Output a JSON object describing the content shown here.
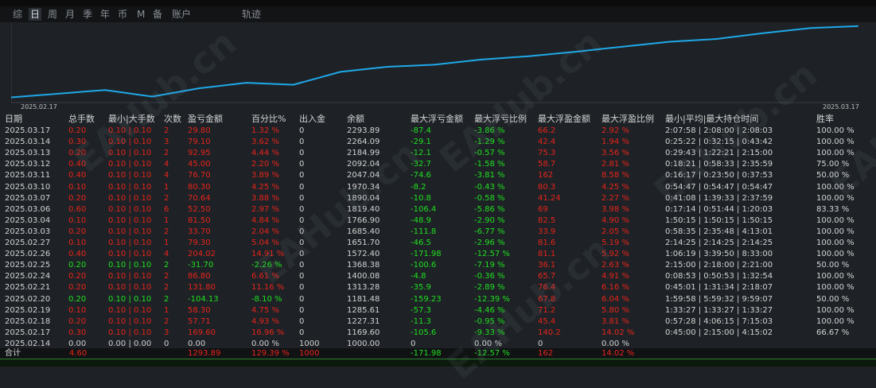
{
  "tabs": [
    "综",
    "日",
    "周",
    "月",
    "季",
    "年",
    "币",
    "M",
    "备",
    "账户",
    "轨迹"
  ],
  "active_tab": "日",
  "chart_data": {
    "type": "line",
    "x": [
      "2025.02.17",
      "2025.02.18",
      "2025.02.19",
      "2025.02.20",
      "2025.02.21",
      "2025.02.24",
      "2025.02.25",
      "2025.02.26",
      "2025.02.27",
      "2025.03.03",
      "2025.03.04",
      "2025.03.06",
      "2025.03.07",
      "2025.03.10",
      "2025.03.11",
      "2025.03.12",
      "2025.03.13",
      "2025.03.14",
      "2025.03.17"
    ],
    "values": [
      1169.6,
      1227.31,
      1285.61,
      1181.48,
      1313.28,
      1400.08,
      1368.38,
      1572.4,
      1651.7,
      1685.4,
      1766.9,
      1819.4,
      1890.04,
      1970.34,
      2047.04,
      2092.04,
      2184.99,
      2264.09,
      2293.89
    ],
    "series_color": "#1fa8e8",
    "start_label": "2025.02.17",
    "end_label": "2025.03.17"
  },
  "headers": [
    "日期",
    "总手数",
    "最小|大手数",
    "次数",
    "盈亏金额",
    "百分比%",
    "出入金",
    "余额",
    "最大浮亏金额",
    "最大浮亏比例",
    "最大浮盈金额",
    "最大浮盈比例",
    "最小|平均|最大持仓时间",
    "胜率"
  ],
  "rows": [
    {
      "date": "2025.03.17",
      "lots": "0.20",
      "minmax": "0.10 | 0.10",
      "count": "2",
      "pnl": "29.80",
      "pct": "1.32 %",
      "io": "0",
      "bal": "2293.89",
      "mae": "-87.4",
      "maep": "-3.86 %",
      "mfe": "66.2",
      "mfep": "2.92 %",
      "hold": "2:07:58 | 2:08:00 | 2:08:03",
      "win": "100.00 %",
      "tone": "red"
    },
    {
      "date": "2025.03.14",
      "lots": "0.30",
      "minmax": "0.10 | 0.10",
      "count": "3",
      "pnl": "79.10",
      "pct": "3.62 %",
      "io": "0",
      "bal": "2264.09",
      "mae": "-29.1",
      "maep": "-1.29 %",
      "mfe": "42.4",
      "mfep": "1.94 %",
      "hold": "0:25:22 | 0:32:15 | 0:43:42",
      "win": "100.00 %",
      "tone": "red"
    },
    {
      "date": "2025.03.13",
      "lots": "0.20",
      "minmax": "0.10 | 0.10",
      "count": "2",
      "pnl": "92.95",
      "pct": "4.44 %",
      "io": "0",
      "bal": "2184.99",
      "mae": "-12.1",
      "maep": "-0.57 %",
      "mfe": "75.3",
      "mfep": "3.56 %",
      "hold": "0:29:43 | 1:22:21 | 2:15:00",
      "win": "100.00 %",
      "tone": "red"
    },
    {
      "date": "2025.03.12",
      "lots": "0.40",
      "minmax": "0.10 | 0.10",
      "count": "4",
      "pnl": "45.00",
      "pct": "2.20 %",
      "io": "0",
      "bal": "2092.04",
      "mae": "-32.7",
      "maep": "-1.58 %",
      "mfe": "58.7",
      "mfep": "2.81 %",
      "hold": "0:18:21 | 0:58:33 | 2:35:59",
      "win": "75.00 %",
      "tone": "red"
    },
    {
      "date": "2025.03.11",
      "lots": "0.40",
      "minmax": "0.10 | 0.10",
      "count": "4",
      "pnl": "76.70",
      "pct": "3.89 %",
      "io": "0",
      "bal": "2047.04",
      "mae": "-74.6",
      "maep": "-3.81 %",
      "mfe": "162",
      "mfep": "8.58 %",
      "hold": "0:16:17 | 0:23:50 | 0:37:53",
      "win": "50.00 %",
      "tone": "red"
    },
    {
      "date": "2025.03.10",
      "lots": "0.10",
      "minmax": "0.10 | 0.10",
      "count": "1",
      "pnl": "80.30",
      "pct": "4.25 %",
      "io": "0",
      "bal": "1970.34",
      "mae": "-8.2",
      "maep": "-0.43 %",
      "mfe": "80.3",
      "mfep": "4.25 %",
      "hold": "0:54:47 | 0:54:47 | 0:54:47",
      "win": "100.00 %",
      "tone": "red"
    },
    {
      "date": "2025.03.07",
      "lots": "0.20",
      "minmax": "0.10 | 0.10",
      "count": "2",
      "pnl": "70.64",
      "pct": "3.88 %",
      "io": "0",
      "bal": "1890.04",
      "mae": "-10.8",
      "maep": "-0.58 %",
      "mfe": "41.24",
      "mfep": "2.27 %",
      "hold": "0:41:08 | 1:39:33 | 2:37:59",
      "win": "100.00 %",
      "tone": "red"
    },
    {
      "date": "2025.03.06",
      "lots": "0.60",
      "minmax": "0.10 | 0.10",
      "count": "6",
      "pnl": "52.50",
      "pct": "2.97 %",
      "io": "0",
      "bal": "1819.40",
      "mae": "-106.4",
      "maep": "-5.86 %",
      "mfe": "69",
      "mfep": "3.98 %",
      "hold": "0:17:14 | 0:51:44 | 1:20:03",
      "win": "83.33 %",
      "tone": "red"
    },
    {
      "date": "2025.03.04",
      "lots": "0.10",
      "minmax": "0.10 | 0.10",
      "count": "1",
      "pnl": "81.50",
      "pct": "4.84 %",
      "io": "0",
      "bal": "1766.90",
      "mae": "-48.9",
      "maep": "-2.90 %",
      "mfe": "82.5",
      "mfep": "4.90 %",
      "hold": "1:50:15 | 1:50:15 | 1:50:15",
      "win": "100.00 %",
      "tone": "red"
    },
    {
      "date": "2025.03.03",
      "lots": "0.20",
      "minmax": "0.10 | 0.10",
      "count": "2",
      "pnl": "33.70",
      "pct": "2.04 %",
      "io": "0",
      "bal": "1685.40",
      "mae": "-111.8",
      "maep": "-6.77 %",
      "mfe": "33.9",
      "mfep": "2.05 %",
      "hold": "0:58:35 | 2:35:48 | 4:13:01",
      "win": "100.00 %",
      "tone": "red"
    },
    {
      "date": "2025.02.27",
      "lots": "0.10",
      "minmax": "0.10 | 0.10",
      "count": "1",
      "pnl": "79.30",
      "pct": "5.04 %",
      "io": "0",
      "bal": "1651.70",
      "mae": "-46.5",
      "maep": "-2.96 %",
      "mfe": "81.6",
      "mfep": "5.19 %",
      "hold": "2:14:25 | 2:14:25 | 2:14:25",
      "win": "100.00 %",
      "tone": "red"
    },
    {
      "date": "2025.02.26",
      "lots": "0.40",
      "minmax": "0.10 | 0.10",
      "count": "4",
      "pnl": "204.02",
      "pct": "14.91 %",
      "io": "0",
      "bal": "1572.40",
      "mae": "-171.98",
      "maep": "-12.57 %",
      "mfe": "81.1",
      "mfep": "5.92 %",
      "hold": "1:06:19 | 3:39:50 | 8:33:00",
      "win": "100.00 %",
      "tone": "red"
    },
    {
      "date": "2025.02.25",
      "lots": "0.20",
      "minmax": "0.10 | 0.10",
      "count": "2",
      "pnl": "-31.70",
      "pct": "-2.26 %",
      "io": "0",
      "bal": "1368.38",
      "mae": "-100.6",
      "maep": "-7.19 %",
      "mfe": "36.1",
      "mfep": "2.63 %",
      "hold": "2:15:00 | 2:18:00 | 2:21:00",
      "win": "50.00 %",
      "tone": "green"
    },
    {
      "date": "2025.02.24",
      "lots": "0.20",
      "minmax": "0.10 | 0.10",
      "count": "2",
      "pnl": "86.80",
      "pct": "6.61 %",
      "io": "0",
      "bal": "1400.08",
      "mae": "-4.8",
      "maep": "-0.36 %",
      "mfe": "65.7",
      "mfep": "4.91 %",
      "hold": "0:08:53 | 0:50:53 | 1:32:54",
      "win": "100.00 %",
      "tone": "red"
    },
    {
      "date": "2025.02.21",
      "lots": "0.20",
      "minmax": "0.10 | 0.10",
      "count": "2",
      "pnl": "131.80",
      "pct": "11.16 %",
      "io": "0",
      "bal": "1313.28",
      "mae": "-35.9",
      "maep": "-2.89 %",
      "mfe": "76.4",
      "mfep": "6.16 %",
      "hold": "0:45:01 | 1:31:34 | 2:18:07",
      "win": "100.00 %",
      "tone": "red"
    },
    {
      "date": "2025.02.20",
      "lots": "0.20",
      "minmax": "0.10 | 0.10",
      "count": "2",
      "pnl": "-104.13",
      "pct": "-8.10 %",
      "io": "0",
      "bal": "1181.48",
      "mae": "-159.23",
      "maep": "-12.39 %",
      "mfe": "67.8",
      "mfep": "6.04 %",
      "hold": "1:59:58 | 5:59:32 | 9:59:07",
      "win": "50.00 %",
      "tone": "green"
    },
    {
      "date": "2025.02.19",
      "lots": "0.10",
      "minmax": "0.10 | 0.10",
      "count": "1",
      "pnl": "58.30",
      "pct": "4.75 %",
      "io": "0",
      "bal": "1285.61",
      "mae": "-57.3",
      "maep": "-4.46 %",
      "mfe": "71.2",
      "mfep": "5.80 %",
      "hold": "1:33:27 | 1:33:27 | 1:33:27",
      "win": "100.00 %",
      "tone": "red"
    },
    {
      "date": "2025.02.18",
      "lots": "0.20",
      "minmax": "0.10 | 0.10",
      "count": "2",
      "pnl": "57.71",
      "pct": "4.93 %",
      "io": "0",
      "bal": "1227.31",
      "mae": "-11.3",
      "maep": "-0.95 %",
      "mfe": "45.4",
      "mfep": "3.81 %",
      "hold": "0:57:28 | 4:06:15 | 7:15:03",
      "win": "100.00 %",
      "tone": "red"
    },
    {
      "date": "2025.02.17",
      "lots": "0.30",
      "minmax": "0.10 | 0.10",
      "count": "3",
      "pnl": "169.60",
      "pct": "16.96 %",
      "io": "0",
      "bal": "1169.60",
      "mae": "-105.6",
      "maep": "-9.33 %",
      "mfe": "140.2",
      "mfep": "14.02 %",
      "hold": "0:45:00 | 2:15:00 | 4:15:02",
      "win": "66.67 %",
      "tone": "red"
    },
    {
      "date": "2025.02.14",
      "lots": "0.00",
      "minmax": "0.00 | 0.00",
      "count": "0",
      "pnl": "0.00",
      "pct": "0.00 %",
      "io": "1000",
      "bal": "1000.00",
      "mae": "0",
      "maep": "0.00 %",
      "mfe": "0",
      "mfep": "0.00 %",
      "hold": "",
      "win": "",
      "tone": "white"
    }
  ],
  "total": {
    "label": "合计",
    "lots": "4.60",
    "pnl": "1293.89",
    "pct": "129.39 %",
    "io": "1000",
    "mae": "-171.98",
    "maep": "-12.57 %",
    "mfe": "162",
    "mfep": "14.02 %"
  },
  "watermark": "EAHub.cn"
}
